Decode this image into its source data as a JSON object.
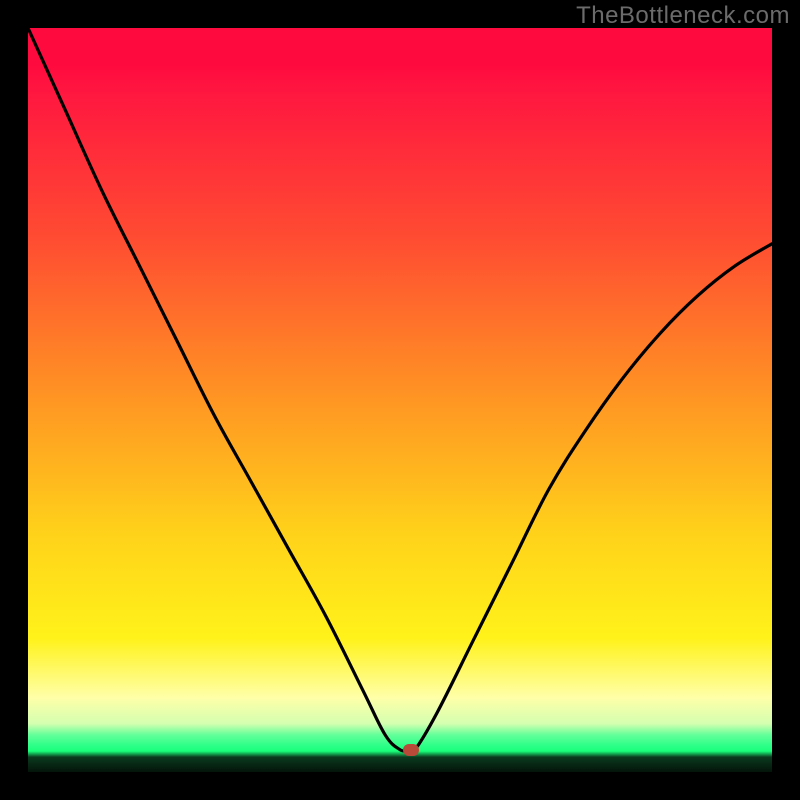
{
  "watermark": "TheBottleneck.com",
  "chart_data": {
    "type": "line",
    "title": "",
    "xlabel": "",
    "ylabel": "",
    "xlim": [
      0,
      1
    ],
    "ylim": [
      0,
      1
    ],
    "series": [
      {
        "name": "bottleneck-curve",
        "x": [
          0.0,
          0.05,
          0.1,
          0.15,
          0.2,
          0.25,
          0.3,
          0.35,
          0.4,
          0.45,
          0.48,
          0.5,
          0.51,
          0.52,
          0.55,
          0.6,
          0.65,
          0.7,
          0.75,
          0.8,
          0.85,
          0.9,
          0.95,
          1.0
        ],
        "y": [
          1.0,
          0.89,
          0.78,
          0.68,
          0.58,
          0.48,
          0.39,
          0.3,
          0.21,
          0.11,
          0.05,
          0.03,
          0.03,
          0.03,
          0.08,
          0.18,
          0.28,
          0.38,
          0.46,
          0.53,
          0.59,
          0.64,
          0.68,
          0.71
        ]
      }
    ],
    "marker": {
      "x": 0.515,
      "y": 0.03,
      "color": "#b94a3a"
    }
  },
  "colors": {
    "background": "#000000",
    "curve": "#000000",
    "marker": "#b94a3a",
    "watermark": "#6b6b6b"
  }
}
